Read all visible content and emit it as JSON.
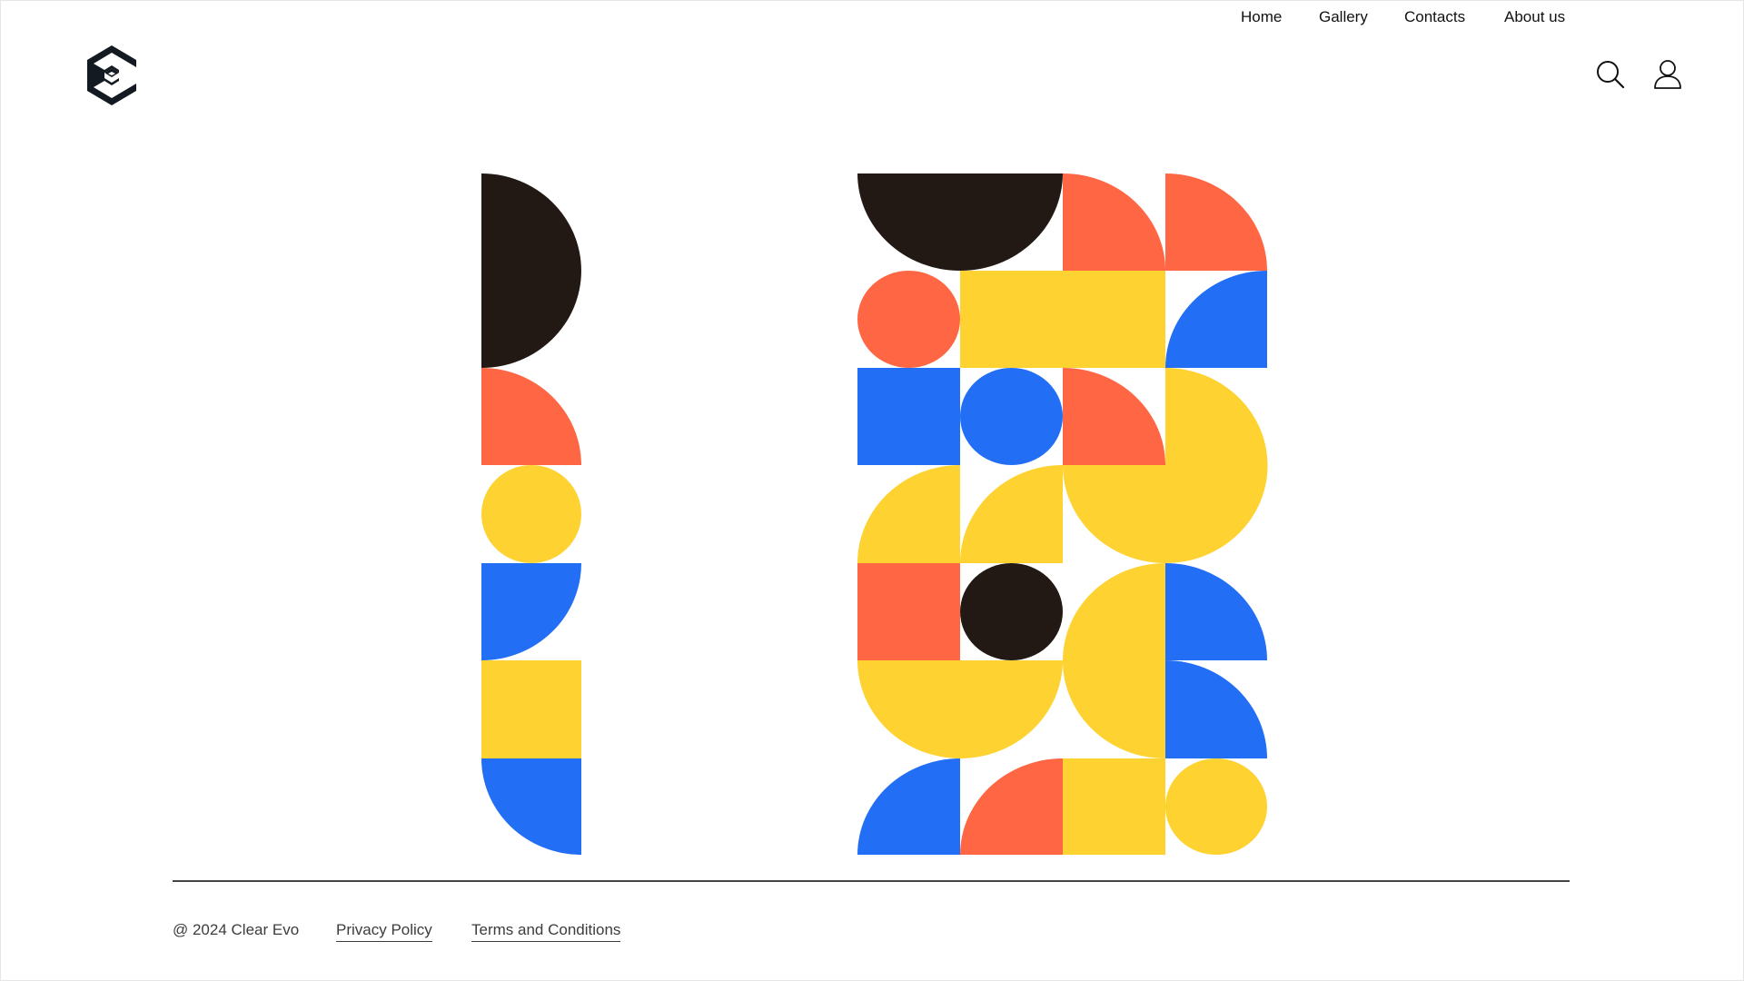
{
  "header": {
    "logo_icon": "cube-c-logo-icon",
    "nav": [
      {
        "label": "Home"
      },
      {
        "label": "Gallery"
      },
      {
        "label": "Contacts"
      },
      {
        "label": "About us"
      }
    ],
    "search_icon": "search-icon",
    "account_icon": "user-icon"
  },
  "colors": {
    "dark": "#221915",
    "orange": "#ff6643",
    "yellow": "#fdd231",
    "blue": "#226ef5",
    "divider": "#444444"
  },
  "footer": {
    "copyright": "@ 2024 Clear Evo",
    "privacy": "Privacy Policy",
    "terms": "Terms and Conditions"
  }
}
